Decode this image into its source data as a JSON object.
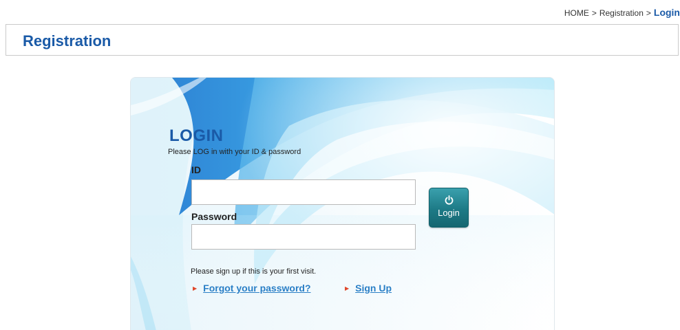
{
  "breadcrumb": {
    "home": "HOME",
    "separator": ">",
    "section": "Registration",
    "current": "Login"
  },
  "header": {
    "title": "Registration"
  },
  "login": {
    "title": "LOGIN",
    "subtitle": "Please LOG in with your ID & password",
    "id_label": "ID",
    "id_value": "",
    "password_label": "Password",
    "password_value": "",
    "button_icon": "power-icon",
    "button_label": "Login",
    "signup_hint": "Please sign up if this is your first visit.",
    "forgot_link": "Forgot your password?",
    "signup_link": "Sign Up"
  },
  "colors": {
    "brand_blue": "#1a5aa7",
    "link_blue": "#2a7fc6",
    "button_teal": "#1d7a86",
    "arrow_red": "#e0472a"
  }
}
